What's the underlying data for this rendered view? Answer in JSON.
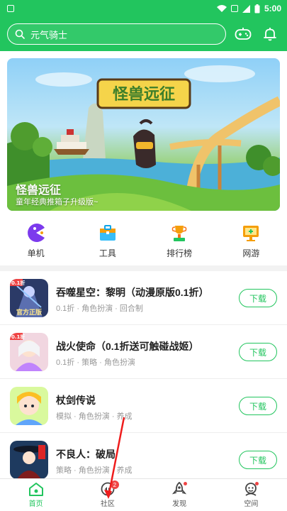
{
  "status_bar": {
    "time": "5:00"
  },
  "header": {
    "search_placeholder": "元气骑士"
  },
  "banner": {
    "title": "怪兽远征",
    "subtitle": "童年经典推箱子升级版~",
    "logo_text": "怪兽远征"
  },
  "quick_links": [
    {
      "label": "单机",
      "icon": "pacman-icon"
    },
    {
      "label": "工具",
      "icon": "toolbox-icon"
    },
    {
      "label": "排行榜",
      "icon": "trophy-icon"
    },
    {
      "label": "网游",
      "icon": "monitor-icon"
    }
  ],
  "games": [
    {
      "name": "吞噬星空：黎明（动漫原版0.1折）",
      "tags": "0.1折 · 角色扮演 · 回合制",
      "button": "下载",
      "icon_badge": "0.1折",
      "icon_caption": "官方正版"
    },
    {
      "name": "战火使命（0.1折送可触碰战姬）",
      "tags": "0.1折 · 策略 · 角色扮演",
      "button": "下载",
      "icon_badge": "0.1折"
    },
    {
      "name": "杖剑传说",
      "tags": "模拟 · 角色扮演 · 养成",
      "button": "下载"
    },
    {
      "name": "不良人：破局",
      "tags": "策略 · 角色扮演 · 养成",
      "button": "下载"
    }
  ],
  "bottom_nav": [
    {
      "label": "首页",
      "active": true
    },
    {
      "label": "社区",
      "badge": "2"
    },
    {
      "label": "发现"
    },
    {
      "label": "空间"
    }
  ],
  "colors": {
    "brand": "#22c55e",
    "badge": "#ef4444"
  }
}
